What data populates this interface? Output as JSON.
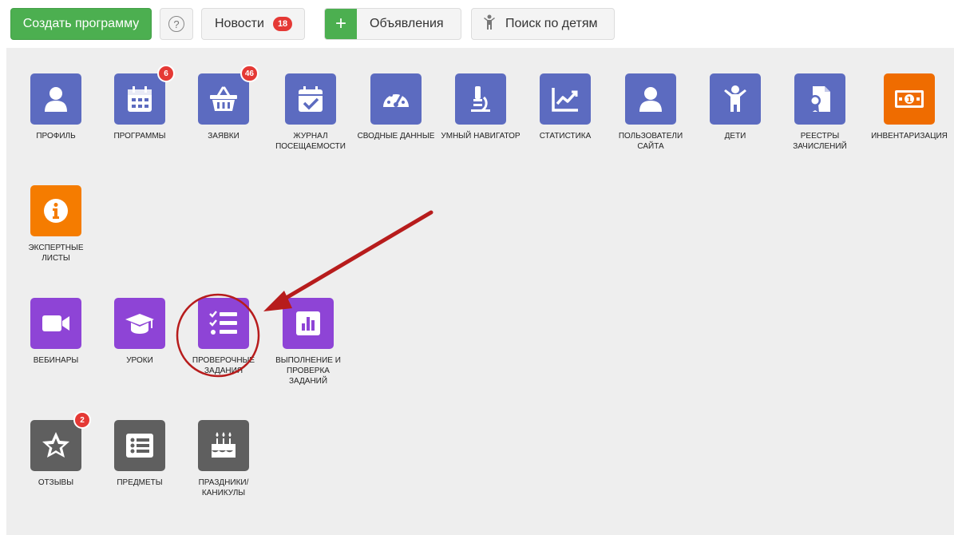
{
  "topbar": {
    "create_label": "Создать программу",
    "help_icon": "question-circle-icon",
    "news_label": "Новости",
    "news_count": "18",
    "ads_plus": "+",
    "ads_label": "Объявления",
    "kids_label": "Поиск по детям"
  },
  "colors": {
    "green": "#4caf50",
    "blue_tile": "#5c6bc0",
    "orange_tile": "#f57c00",
    "purple_tile": "#8e44d6",
    "grey_tile": "#5f5f5f",
    "badge_red": "#e53935",
    "annotation_red": "#b71c1c"
  },
  "tiles": {
    "profile": {
      "label": "Профиль",
      "icon": "user-icon"
    },
    "programs": {
      "label": "Программы",
      "icon": "calendar-icon",
      "badge": "6"
    },
    "requests": {
      "label": "Заявки",
      "icon": "basket-icon",
      "badge": "46"
    },
    "attendance": {
      "label": "Журнал посещаемости",
      "icon": "calendar-check-icon"
    },
    "summary": {
      "label": "Сводные данные",
      "icon": "gauge-icon"
    },
    "navigator": {
      "label": "Умный навигатор",
      "icon": "microscope-icon"
    },
    "statistics": {
      "label": "Статистика",
      "icon": "chart-line-icon"
    },
    "users": {
      "label": "Пользователи сайта",
      "icon": "user-icon"
    },
    "children": {
      "label": "Дети",
      "icon": "child-icon"
    },
    "registries": {
      "label": "Реестры зачислений",
      "icon": "certificate-icon"
    },
    "inventory": {
      "label": "Инвентаризация",
      "icon": "money-bill-icon"
    },
    "expert": {
      "label": "Экспертные листы",
      "icon": "info-icon"
    },
    "webinars": {
      "label": "Вебинары",
      "icon": "video-icon"
    },
    "lessons": {
      "label": "Уроки",
      "icon": "graduation-cap-icon"
    },
    "tests": {
      "label": "Проверочные задания",
      "icon": "tasks-icon"
    },
    "checking": {
      "label": "Выполнение и проверка заданий",
      "icon": "poll-icon"
    },
    "reviews": {
      "label": "Отзывы",
      "icon": "star-icon",
      "badge": "2"
    },
    "subjects": {
      "label": "Предметы",
      "icon": "list-alt-icon"
    },
    "holidays": {
      "label": "Праздники/ каникулы",
      "icon": "birthday-cake-icon"
    }
  }
}
